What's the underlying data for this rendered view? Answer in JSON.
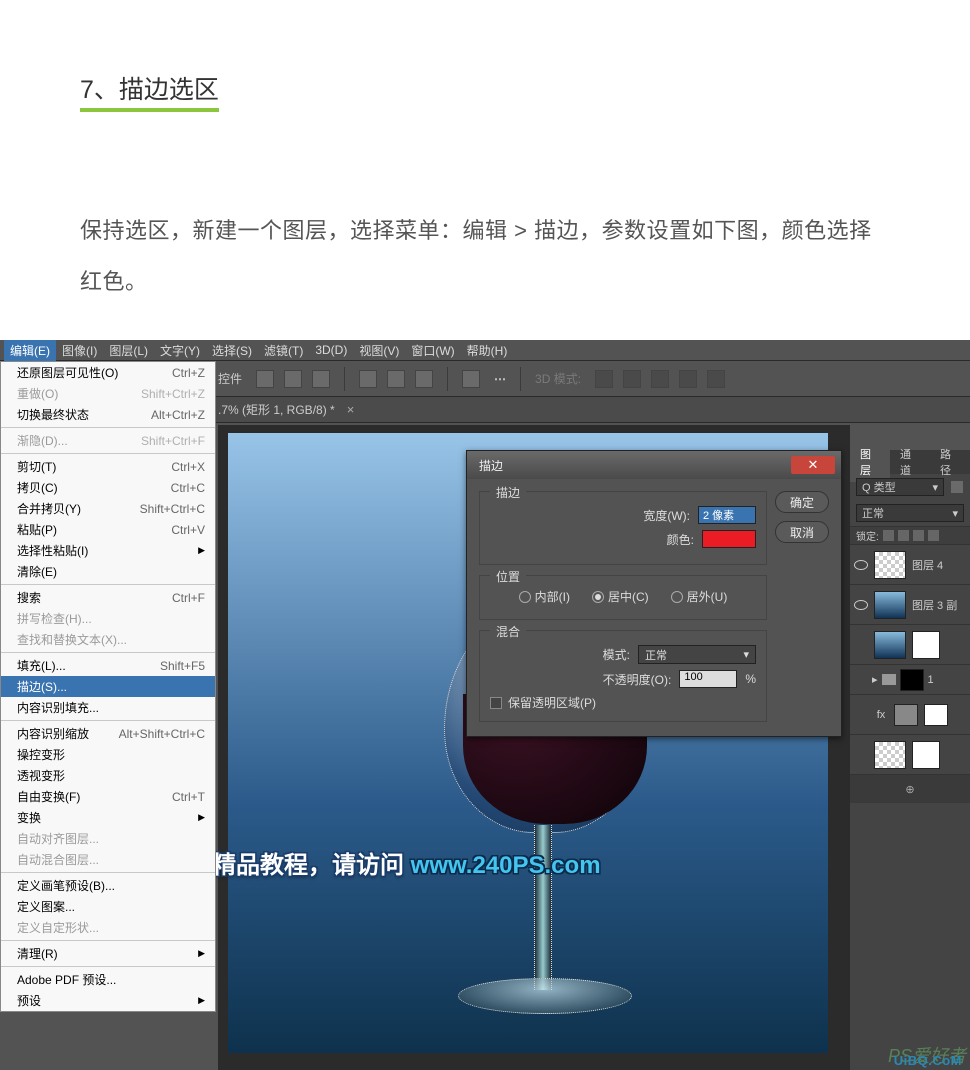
{
  "doc": {
    "step_title": "7、描边选区",
    "step_body": "保持选区，新建一个图层，选择菜单：编辑 > 描边，参数设置如下图，颜色选择红色。"
  },
  "menubar": {
    "items": [
      "编辑(E)",
      "图像(I)",
      "图层(L)",
      "文字(Y)",
      "选择(S)",
      "滤镜(T)",
      "3D(D)",
      "视图(V)",
      "窗口(W)",
      "帮助(H)"
    ],
    "active_index": 0
  },
  "optionsbar": {
    "group_label": "控件",
    "mode3d_label": "3D 模式:"
  },
  "document_tab": {
    "title": ".7% (矩形 1, RGB/8) *",
    "close": "×"
  },
  "edit_menu": {
    "rows": [
      {
        "label": "还原图层可见性(O)",
        "shortcut": "Ctrl+Z",
        "disabled": false
      },
      {
        "label": "重做(O)",
        "shortcut": "Shift+Ctrl+Z",
        "disabled": true
      },
      {
        "label": "切换最终状态",
        "shortcut": "Alt+Ctrl+Z",
        "disabled": false
      },
      {
        "sep": true
      },
      {
        "label": "渐隐(D)...",
        "shortcut": "Shift+Ctrl+F",
        "disabled": true
      },
      {
        "sep": true
      },
      {
        "label": "剪切(T)",
        "shortcut": "Ctrl+X",
        "disabled": false
      },
      {
        "label": "拷贝(C)",
        "shortcut": "Ctrl+C",
        "disabled": false
      },
      {
        "label": "合并拷贝(Y)",
        "shortcut": "Shift+Ctrl+C",
        "disabled": false
      },
      {
        "label": "粘贴(P)",
        "shortcut": "Ctrl+V",
        "disabled": false
      },
      {
        "label": "选择性粘贴(I)",
        "shortcut": "",
        "disabled": false,
        "submenu": true
      },
      {
        "label": "清除(E)",
        "shortcut": "",
        "disabled": false
      },
      {
        "sep": true
      },
      {
        "label": "搜索",
        "shortcut": "Ctrl+F",
        "disabled": false
      },
      {
        "label": "拼写检查(H)...",
        "shortcut": "",
        "disabled": true
      },
      {
        "label": "查找和替换文本(X)...",
        "shortcut": "",
        "disabled": true
      },
      {
        "sep": true
      },
      {
        "label": "填充(L)...",
        "shortcut": "Shift+F5",
        "disabled": false
      },
      {
        "label": "描边(S)...",
        "shortcut": "",
        "disabled": false,
        "highlight": true
      },
      {
        "label": "内容识别填充...",
        "shortcut": "",
        "disabled": false
      },
      {
        "sep": true
      },
      {
        "label": "内容识别缩放",
        "shortcut": "Alt+Shift+Ctrl+C",
        "disabled": false
      },
      {
        "label": "操控变形",
        "shortcut": "",
        "disabled": false
      },
      {
        "label": "透视变形",
        "shortcut": "",
        "disabled": false
      },
      {
        "label": "自由变换(F)",
        "shortcut": "Ctrl+T",
        "disabled": false
      },
      {
        "label": "变换",
        "shortcut": "",
        "disabled": false,
        "submenu": true
      },
      {
        "label": "自动对齐图层...",
        "shortcut": "",
        "disabled": true
      },
      {
        "label": "自动混合图层...",
        "shortcut": "",
        "disabled": true
      },
      {
        "sep": true
      },
      {
        "label": "定义画笔预设(B)...",
        "shortcut": "",
        "disabled": false
      },
      {
        "label": "定义图案...",
        "shortcut": "",
        "disabled": false
      },
      {
        "label": "定义自定形状...",
        "shortcut": "",
        "disabled": true
      },
      {
        "sep": true
      },
      {
        "label": "清理(R)",
        "shortcut": "",
        "disabled": false,
        "submenu": true
      },
      {
        "sep": true
      },
      {
        "label": "Adobe PDF 预设...",
        "shortcut": "",
        "disabled": false
      },
      {
        "label": "预设",
        "shortcut": "",
        "disabled": false,
        "submenu": true
      }
    ]
  },
  "stroke_dialog": {
    "title": "描边",
    "ok": "确定",
    "cancel": "取消",
    "stroke_legend": "描边",
    "width_label": "宽度(W):",
    "width_value": "2 像素",
    "color_label": "颜色:",
    "color_value": "#ec1c24",
    "position_legend": "位置",
    "pos_inside": "内部(I)",
    "pos_center": "居中(C)",
    "pos_outside": "居外(U)",
    "pos_selected": "center",
    "blend_legend": "混合",
    "mode_label": "模式:",
    "mode_value": "正常",
    "opacity_label": "不透明度(O):",
    "opacity_value": "100",
    "opacity_pct": "%",
    "preserve_label": "保留透明区域(P)"
  },
  "layers_panel": {
    "tabs": [
      "图层",
      "通道",
      "路径"
    ],
    "active_tab": 0,
    "kind_label": "Q 类型",
    "blend_mode": "正常",
    "lock_label": "锁定:",
    "layers": [
      {
        "visible": true,
        "thumb": "checker",
        "name": "图层 4"
      },
      {
        "visible": true,
        "thumb": "glass",
        "name": "图层 3 副"
      },
      {
        "visible": false,
        "thumb": "glass",
        "mask": true,
        "name": ""
      },
      {
        "visible": false,
        "folder": true,
        "mask_black": true,
        "name": "1"
      },
      {
        "visible": false,
        "fx": true,
        "mask": true,
        "name": ""
      },
      {
        "visible": false,
        "thumb": "checker",
        "mask": true,
        "name": ""
      }
    ],
    "link_sym": "⊕"
  },
  "watermark": {
    "text_a": "更多精品教程，请访问 ",
    "url": "www.240PS.com"
  },
  "corner_wm": "PS爱好者",
  "uibq": "UiBQ.CoM"
}
